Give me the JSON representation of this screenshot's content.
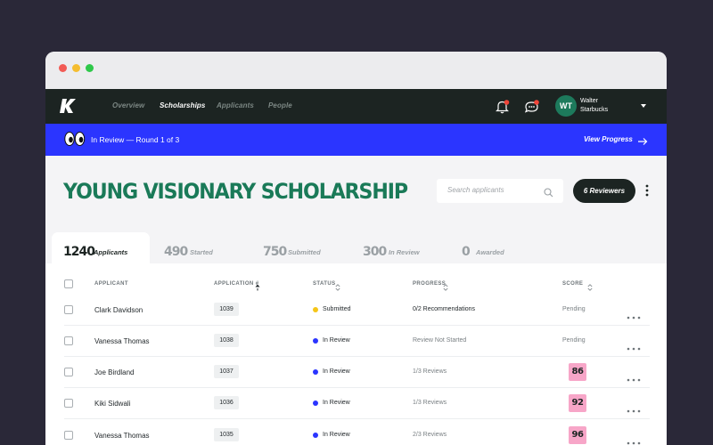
{
  "nav": {
    "links": [
      "Overview",
      "Scholarships",
      "Applicants",
      "People"
    ],
    "user": {
      "initials": "WT",
      "first_name": "Walter",
      "last_name": "Starbucks"
    }
  },
  "banner": {
    "status": "In Review —  Round 1 of 3",
    "action": "View Progress"
  },
  "page": {
    "title": "YOUNG VISIONARY SCHOLARSHIP",
    "search_placeholder": "Search applicants",
    "reviewers_button": "6 Reviewers"
  },
  "tabs": [
    {
      "count": "1240",
      "label": "Applicants"
    },
    {
      "count": "490",
      "label": "Started"
    },
    {
      "count": "750",
      "label": "Submitted"
    },
    {
      "count": "300",
      "label": "In Review"
    },
    {
      "count": "0",
      "label": "Awarded"
    }
  ],
  "table": {
    "headers": [
      "APPLICANT",
      "APPLICATION #",
      "STATUS",
      "PROGRESS",
      "SCORE"
    ],
    "rows": [
      {
        "name": "Clark Davidson",
        "app_no": "1039",
        "status": "Submitted",
        "progress": "0/2 Recommendations",
        "score": "Pending"
      },
      {
        "name": "Vanessa Thomas",
        "app_no": "1038",
        "status": "In Review",
        "progress": "Review Not Started",
        "score": "Pending"
      },
      {
        "name": "Joe Birdland",
        "app_no": "1037",
        "status": "In Review",
        "progress": "1/3 Reviews",
        "score": "86"
      },
      {
        "name": "Kiki Sidwali",
        "app_no": "1036",
        "status": "In Review",
        "progress": "1/3 Reviews",
        "score": "92"
      },
      {
        "name": "Vanessa Thomas",
        "app_no": "1035",
        "status": "In Review",
        "progress": "2/3 Reviews",
        "score": "96"
      }
    ]
  },
  "colors": {
    "brand_green": "#1a7a58",
    "banner_blue": "#2b35ff",
    "nav_dark": "#1c2422",
    "status_submitted": "#f5c518",
    "status_in_review": "#2b35ff",
    "score_badge": "#f7a6c8"
  },
  "icons": [
    "logo-k-icon",
    "bell-icon",
    "chat-icon",
    "eyes-icon",
    "arrow-right-icon",
    "search-icon",
    "kebab-icon",
    "sort-icon",
    "more-icon"
  ]
}
